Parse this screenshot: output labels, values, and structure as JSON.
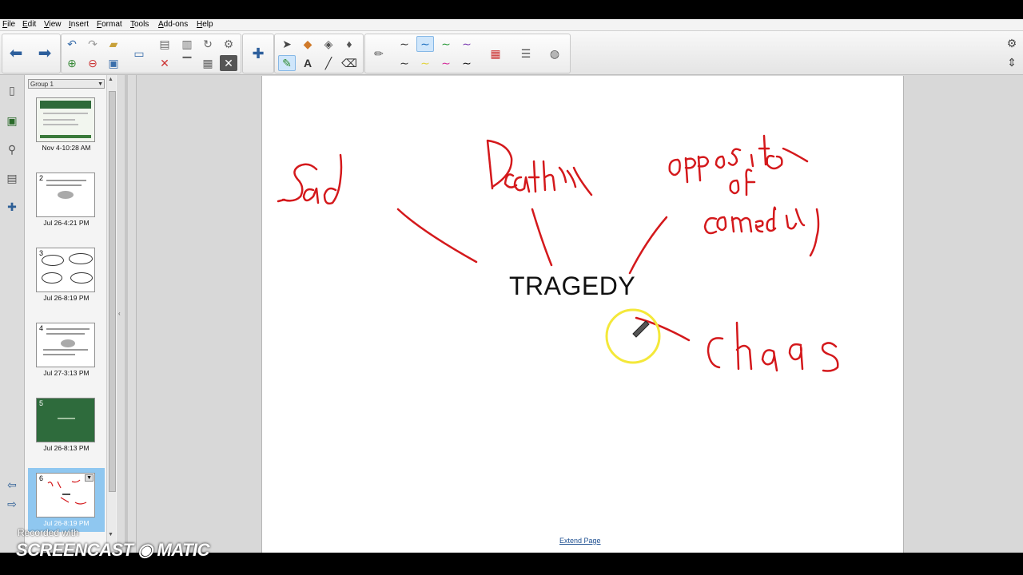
{
  "menu": [
    "File",
    "Edit",
    "View",
    "Insert",
    "Format",
    "Tools",
    "Add-ons",
    "Help"
  ],
  "sorter": {
    "group_label": "Group 1",
    "slides": [
      {
        "number": "",
        "timestamp": "Nov 4-10:28 AM"
      },
      {
        "number": "2",
        "timestamp": "Jul 26-4:21 PM"
      },
      {
        "number": "3",
        "timestamp": "Jul 26-8:19 PM"
      },
      {
        "number": "4",
        "timestamp": "Jul 27-3:13 PM"
      },
      {
        "number": "5",
        "timestamp": "Jul 26-8:13 PM"
      },
      {
        "number": "6",
        "timestamp": "Jul 26-8:19 PM"
      }
    ]
  },
  "canvas": {
    "main_text": "TRAGEDY",
    "extend_link": "Extend Page",
    "ink_color": "#d4191c",
    "cursor_highlight_color": "#f4e83a"
  },
  "watermark": {
    "line1": "Recorded with",
    "line2": "SCREENCAST ◉ MATIC"
  },
  "colors": {
    "selected_slide": "#8fc7f0",
    "toolbar_selected": "#cfe6fb"
  }
}
